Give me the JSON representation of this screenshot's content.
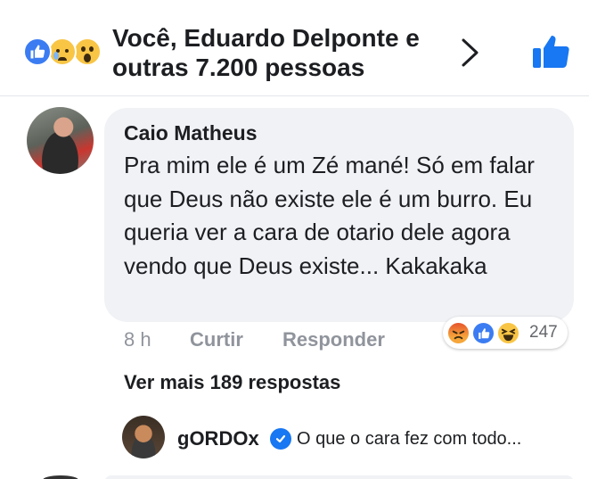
{
  "reactions_bar": {
    "summary": "Você, Eduardo Delponte e outras 7.200 pessoas",
    "icons": [
      "like-icon",
      "sad-icon",
      "wow-icon"
    ],
    "accent_color": "#3b7cf2"
  },
  "comment": {
    "author": "Caio Matheus",
    "text": "Pra mim ele é um Zé mané! Só em falar que Deus não existe ele é um burro. Eu queria ver a cara de otario dele agora vendo que Deus existe... Kakakaka",
    "time": "8 h",
    "like_label": "Curtir",
    "reply_label": "Responder",
    "reactions": [
      "angry-icon",
      "like-icon",
      "haha-icon"
    ],
    "reaction_count": "247"
  },
  "replies": {
    "more_label": "Ver mais 189 respostas",
    "preview": {
      "author": "gORDOx",
      "verified": true,
      "text": "O que o cara fez com todo..."
    }
  }
}
